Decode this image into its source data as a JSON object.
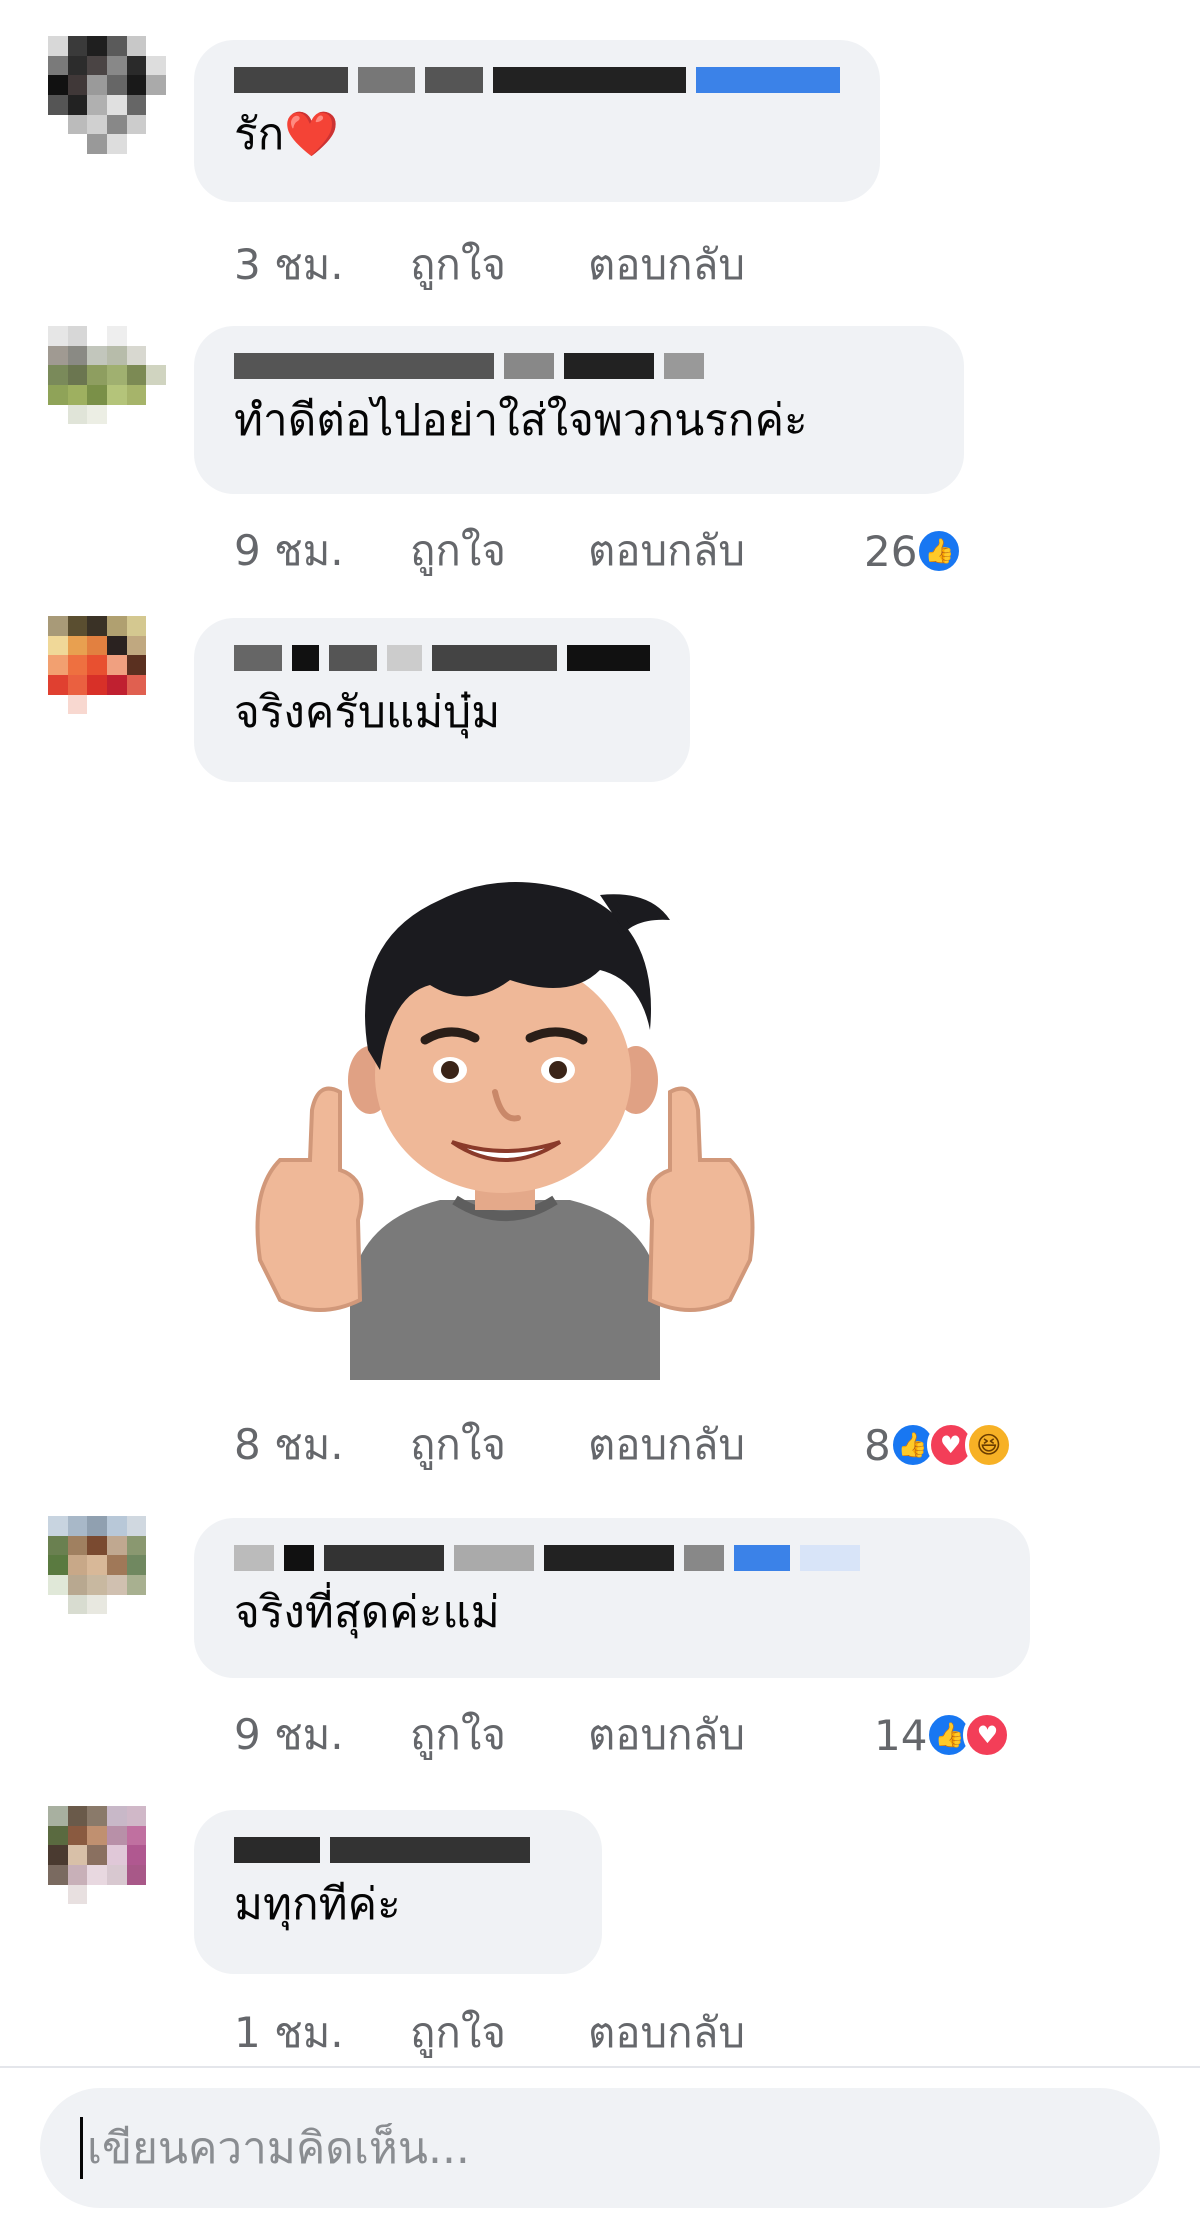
{
  "comments": [
    {
      "text": "รัก❤️",
      "time": "3 ชม.",
      "like": "ถูกใจ",
      "reply": "ตอบกลับ",
      "reaction_count": ""
    },
    {
      "text": "ทำดีต่อไปอย่าใส่ใจพวกนรกค่ะ",
      "time": "9 ชม.",
      "like": "ถูกใจ",
      "reply": "ตอบกลับ",
      "reaction_count": "26",
      "reactions": [
        "like-icon"
      ]
    },
    {
      "text": "จริงครับแม่บุ๋ม",
      "time": "8 ชม.",
      "like": "ถูกใจ",
      "reply": "ตอบกลับ",
      "reaction_count": "8",
      "reactions": [
        "like-icon",
        "love-icon",
        "haha-icon"
      ],
      "sticker": "thumbs-up-avatar-sticker"
    },
    {
      "text": "จริงที่สุดค่ะแม่",
      "time": "9 ชม.",
      "like": "ถูกใจ",
      "reply": "ตอบกลับ",
      "reaction_count": "14",
      "reactions": [
        "like-icon",
        "love-icon"
      ]
    },
    {
      "text": "มทุกทีค่ะ",
      "time": "1 ชม.",
      "like": "ถูกใจ",
      "reply": "ตอบกลับ",
      "reaction_count": ""
    }
  ],
  "composer": {
    "placeholder": "เขียนความคิดเห็น..."
  },
  "colors": {
    "bubble": "#f0f2f5",
    "meta_text": "#65676b",
    "like_blue": "#1877f2",
    "love_red": "#f33e58",
    "haha_yellow": "#f7b125"
  }
}
